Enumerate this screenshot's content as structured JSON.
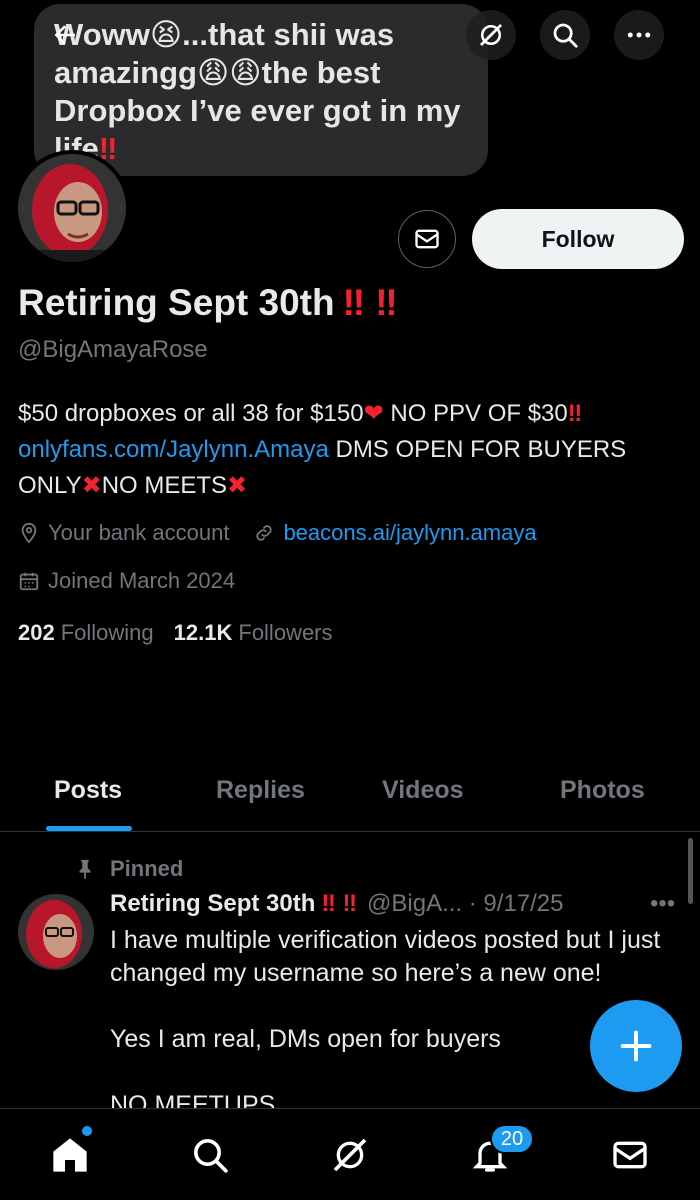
{
  "banner": {
    "text_line1": "Woww😫...that shii was",
    "text_line2": "amazingg😩😩the best",
    "text_line3": "Dropbox I’ve ever got in my",
    "text_line4": "life"
  },
  "profile": {
    "display_name": "Retiring Sept 30th",
    "display_name_marks": "‼️ ‼️",
    "handle": "@BigAmayaRose",
    "follow_label": "Follow",
    "bio_line1_a": "$50 dropboxes or all 38 for $150",
    "bio_heart": "❤️",
    "bio_line1_b": " NO PPV OF $30",
    "bio_marks": "‼️",
    "bio_link": "onlyfans.com/Jaylynn.Amaya",
    "bio_line2": " DMS OPEN FOR BUYERS",
    "bio_line3_a": "ONLY",
    "bio_x": "❌",
    "bio_line3_b": "NO MEETS",
    "location": "Your bank account",
    "website": "beacons.ai/jaylynn.amaya",
    "joined": "Joined March 2024",
    "following_count": "202",
    "following_label": "Following",
    "followers_count": "12.1K",
    "followers_label": "Followers"
  },
  "tabs": [
    "Posts",
    "Replies",
    "Videos",
    "Photos"
  ],
  "post": {
    "pinned_label": "Pinned",
    "author_name": "Retiring Sept 30th",
    "author_marks": "‼️ ‼️",
    "author_handle_date": "@BigA... · 9/17/25",
    "more": "•••",
    "body_p1": "I have multiple verification videos posted but I just changed my username so here’s a new one!",
    "body_p2": "Yes I am real, DMs open for buyers",
    "body_p3": "NO MEETUPS"
  },
  "nav": {
    "notifications_badge": "20"
  },
  "colors": {
    "accent": "#1d9bf0",
    "muted": "#71767b",
    "alert_red": "#f4212e"
  },
  "icons": [
    "back-arrow-icon",
    "grok-icon",
    "search-icon",
    "more-icon",
    "mail-icon",
    "location-icon",
    "link-icon",
    "calendar-icon",
    "pin-icon",
    "plus-icon",
    "home-icon",
    "bell-icon"
  ]
}
